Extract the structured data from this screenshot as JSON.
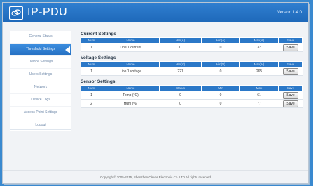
{
  "header": {
    "brand": "IP-PDU",
    "version": "Version 1.4.0"
  },
  "sidebar": {
    "items": [
      {
        "label": "General Status",
        "active": false
      },
      {
        "label": "Threshold Settings",
        "active": true
      },
      {
        "label": "Device Settings",
        "active": false
      },
      {
        "label": "Users Settings",
        "active": false
      },
      {
        "label": "Network",
        "active": false
      },
      {
        "label": "Device Logs",
        "active": false
      },
      {
        "label": "Access Point Settings",
        "active": false
      },
      {
        "label": "Logout",
        "active": false
      }
    ]
  },
  "current": {
    "title": "Current Settings",
    "headers": [
      "Num",
      "Name",
      "Min(A)",
      "Min(A)",
      "Max(A)",
      "Save"
    ],
    "rows": [
      {
        "num": "1",
        "name": "Line 1 current",
        "min1": "0",
        "min2": "0",
        "max": "32",
        "save": "Save"
      }
    ]
  },
  "voltage": {
    "title": "Voltage Settings",
    "headers": [
      "Num",
      "Name",
      "Min(V)",
      "Min(V)",
      "Max(V)",
      "Save"
    ],
    "rows": [
      {
        "num": "1",
        "name": "Line 1 voltage",
        "min1": "221",
        "min2": "0",
        "max": "265",
        "save": "Save"
      }
    ]
  },
  "sensor": {
    "title": "Sensor Settings:",
    "headers": [
      "Num",
      "Name",
      "Status",
      "Min",
      "Max",
      "Save"
    ],
    "rows": [
      {
        "num": "1",
        "name": "Temp (°C)",
        "status": "0",
        "min": "0",
        "max": "61",
        "save": "Save"
      },
      {
        "num": "2",
        "name": "Hum (%)",
        "status": "0",
        "min": "0",
        "max": "77",
        "save": "Save"
      }
    ]
  },
  "footer": {
    "copyright": "Copyright© 2005-2015, Shenzhen Clever Electronic Co.,LTD All rights reserved"
  },
  "colors": {
    "header": "#1e68b9",
    "accent": "#2b78c8",
    "background": "#f1f3f6"
  }
}
